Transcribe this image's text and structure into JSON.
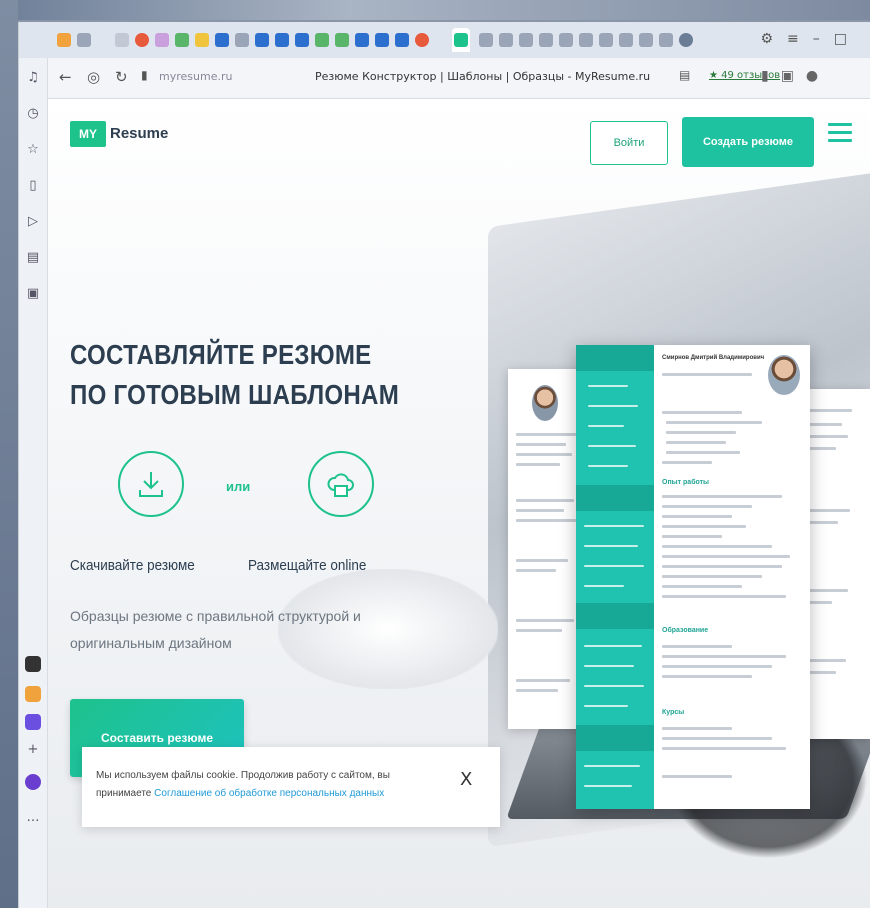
{
  "browser": {
    "page_title": "Резюме Конструктор | Шаблоны | Образцы - MyResume.ru",
    "url": "myresume.ru",
    "reviews_label": "★ 49 отзывов"
  },
  "site": {
    "logo_mark": "MY",
    "logo_text": "Resume",
    "login_label": "Войти",
    "create_label": "Создать резюме"
  },
  "hero": {
    "headline_line1": "СОСТАВЛЯЙТЕ РЕЗЮМЕ",
    "headline_line2": "ПО ГОТОВЫМ ШАБЛОНАМ",
    "or_label": "или",
    "download_label": "Скачивайте резюме",
    "online_label": "Размещайте online",
    "description": "Образцы резюме с правильной структурой и оригинальным дизайном",
    "cta_label": "Составить резюме"
  },
  "resume_preview": {
    "name": "Смирнов Дмитрий Владимирович",
    "section_experience": "Опыт работы",
    "section_education": "Образование",
    "section_courses": "Курсы"
  },
  "cookie": {
    "text_before": "Мы используем файлы cookie. Продолжив работу с сайтом, вы принимаете ",
    "link_text": "Соглашение об обработке персональных данных",
    "close_label": "X"
  },
  "colors": {
    "brand_green": "#1ec28b",
    "brand_teal": "#1ec2a0"
  }
}
